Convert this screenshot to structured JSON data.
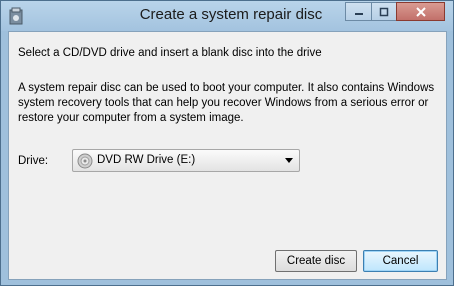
{
  "window": {
    "title": "Create a system repair disc",
    "icons": {
      "app": "disc-app-icon",
      "minimize": "minimize-icon",
      "maximize": "maximize-icon",
      "close": "close-icon"
    }
  },
  "content": {
    "instruction": "Select a CD/DVD drive and insert a blank disc into the drive",
    "description": "A system repair disc can be used to boot your computer. It also contains Windows system recovery tools that can help you recover Windows from a serious error or restore your computer from a system image.",
    "drive_label": "Drive:",
    "drive_selected": "DVD RW Drive (E:)",
    "drive_icon": "dvd-drive-icon"
  },
  "buttons": {
    "create": "Create disc",
    "cancel": "Cancel"
  },
  "colors": {
    "frame": "#9fc0dc",
    "client": "#f0f0f0",
    "close_button": "#c2706a",
    "default_button": "#bee6fd"
  }
}
